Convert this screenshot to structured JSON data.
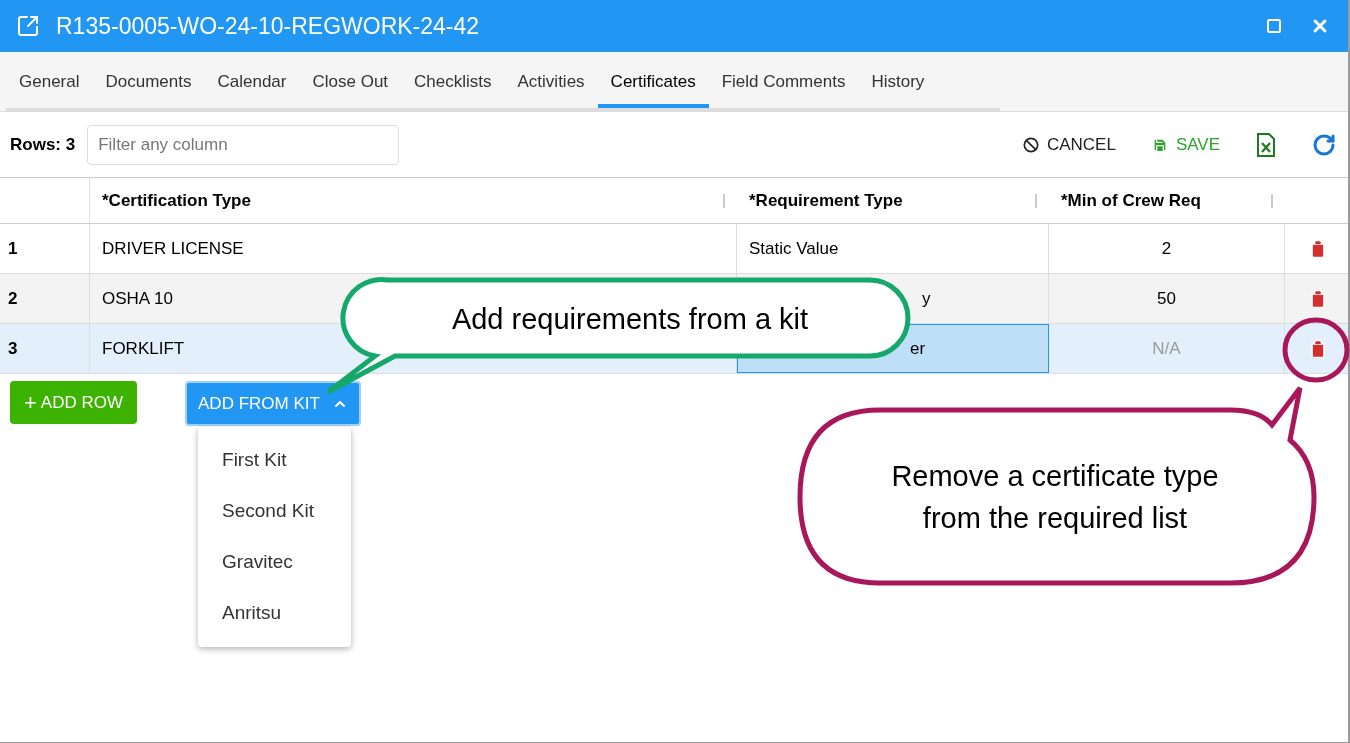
{
  "window": {
    "title": "R135-0005-WO-24-10-REGWORK-24-42"
  },
  "tabs": [
    {
      "label": "General",
      "selected": false
    },
    {
      "label": "Documents",
      "selected": false
    },
    {
      "label": "Calendar",
      "selected": false
    },
    {
      "label": "Close Out",
      "selected": false
    },
    {
      "label": "Checklists",
      "selected": false
    },
    {
      "label": "Activities",
      "selected": false
    },
    {
      "label": "Certificates",
      "selected": true
    },
    {
      "label": "Field Comments",
      "selected": false
    },
    {
      "label": "History",
      "selected": false
    }
  ],
  "toolbar": {
    "rows_label": "Rows: 3",
    "filter": {
      "placeholder": "Filter any column"
    },
    "cancel": "CANCEL",
    "save": "SAVE"
  },
  "table": {
    "columns": [
      "*Certification Type",
      "*Requirement Type",
      "*Min of Crew Req"
    ],
    "rows": [
      {
        "index": "1",
        "certification": "DRIVER LICENSE",
        "requirement": "Static Value",
        "min": "2",
        "selected": false,
        "shaded": false,
        "muted": false
      },
      {
        "index": "2",
        "certification": "OSHA 10",
        "requirement": "y",
        "min": "50",
        "selected": false,
        "shaded": true,
        "muted": false
      },
      {
        "index": "3",
        "certification": "FORKLIFT",
        "requirement": "er",
        "min": "N/A",
        "selected": true,
        "muted": true
      }
    ]
  },
  "actions": {
    "add_row": {
      "icon": "+",
      "label": "ADD ROW"
    },
    "add_from_kit": {
      "label": "ADD FROM KIT",
      "expanded": true
    }
  },
  "kit_menu": [
    "First Kit",
    "Second Kit",
    "Gravitec",
    "Anritsu"
  ],
  "callouts": [
    {
      "text": "Add requirements from a kit",
      "color": "#14a86b"
    },
    {
      "text": "Remove a certificate type from the required list",
      "color": "#a8175a"
    }
  ]
}
